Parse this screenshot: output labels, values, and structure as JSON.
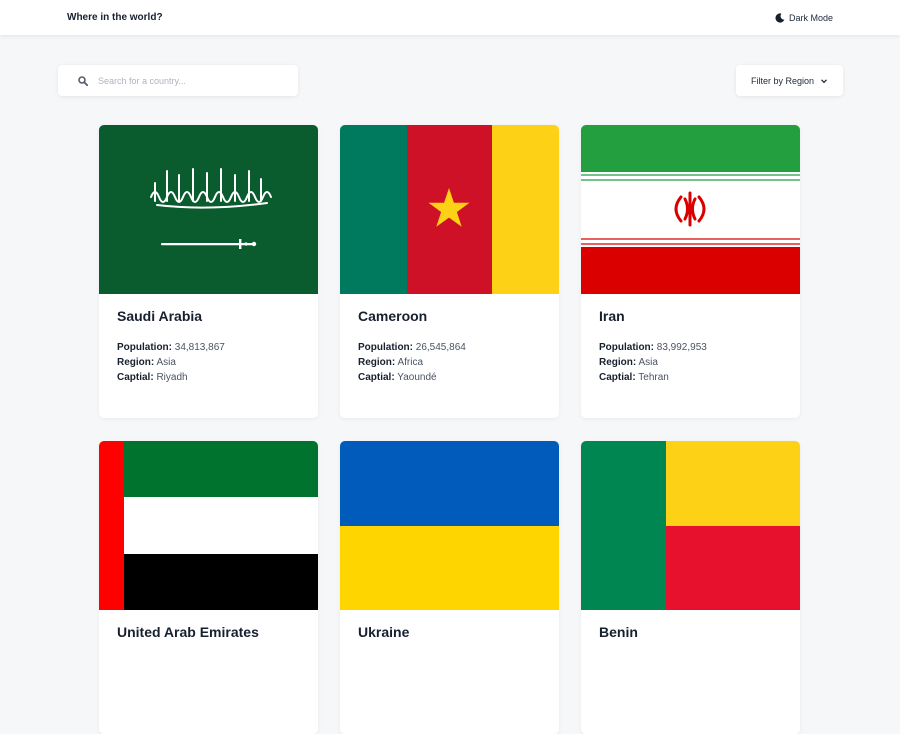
{
  "header": {
    "title": "Where in the world?",
    "mode_label": "Dark Mode"
  },
  "search": {
    "placeholder": "Search for a country...",
    "value": ""
  },
  "filter": {
    "label": "Filter by Region"
  },
  "labels": {
    "population": "Population:",
    "region": "Region:",
    "capital": "Captial:"
  },
  "countries": [
    {
      "name": "Saudi Arabia",
      "population": "34,813,867",
      "region": "Asia",
      "capital": "Riyadh"
    },
    {
      "name": "Cameroon",
      "population": "26,545,864",
      "region": "Africa",
      "capital": "Yaoundé"
    },
    {
      "name": "Iran",
      "population": "83,992,953",
      "region": "Asia",
      "capital": "Tehran"
    },
    {
      "name": "United Arab Emirates",
      "population": "",
      "region": "",
      "capital": ""
    },
    {
      "name": "Ukraine",
      "population": "",
      "region": "",
      "capital": ""
    },
    {
      "name": "Benin",
      "population": "",
      "region": "",
      "capital": ""
    }
  ],
  "colors": {
    "background": "#f6f7f9",
    "surface": "#ffffff",
    "text": "#17202f",
    "saudi_green": "#0a5c2e",
    "cameroon_green": "#007a5e",
    "cameroon_red": "#ce1126",
    "cameroon_yellow": "#fcd116",
    "iran_green": "#239f40",
    "iran_red": "#da0000",
    "uae_red": "#ff0000",
    "uae_green": "#00732f",
    "ukraine_blue": "#005bbb",
    "ukraine_yellow": "#ffd500",
    "benin_green": "#008751",
    "benin_yellow": "#fcd116",
    "benin_red": "#e8112d"
  }
}
